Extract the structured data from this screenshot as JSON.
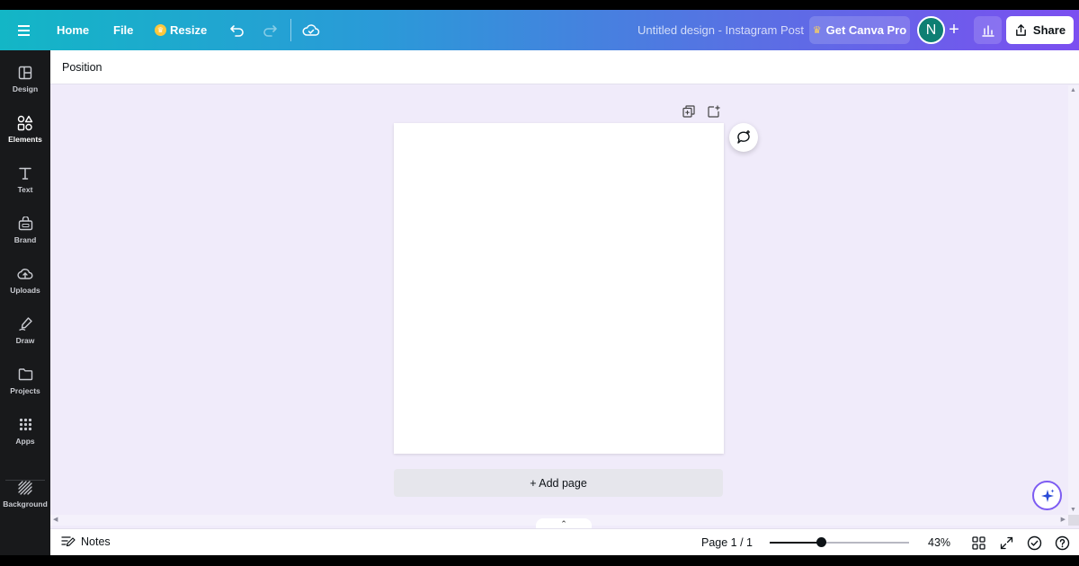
{
  "topbar": {
    "home_label": "Home",
    "file_label": "File",
    "resize_label": "Resize",
    "undo_icon": "undo-icon",
    "redo_icon": "redo-icon",
    "save_status_icon": "cloud-check-icon",
    "document_title": "Untitled design - Instagram Post",
    "get_pro_label": "Get Canva Pro",
    "avatar_initial": "N",
    "add_collaborator_icon": "plus-icon",
    "insights_icon": "bar-chart-icon",
    "share_label": "Share",
    "colors": {
      "gradient_start": "#13b6c6",
      "gradient_end": "#7b4ff0",
      "avatar": "#0e7f73",
      "crown": "#ffd35a"
    }
  },
  "sidebar": {
    "items": [
      {
        "label": "Design",
        "icon": "layout-icon"
      },
      {
        "label": "Elements",
        "icon": "shapes-icon"
      },
      {
        "label": "Text",
        "icon": "text-icon"
      },
      {
        "label": "Brand",
        "icon": "brand-icon"
      },
      {
        "label": "Uploads",
        "icon": "upload-cloud-icon"
      },
      {
        "label": "Draw",
        "icon": "pen-icon"
      },
      {
        "label": "Projects",
        "icon": "folder-icon"
      },
      {
        "label": "Apps",
        "icon": "apps-grid-icon"
      },
      {
        "label": "Background",
        "icon": "hatch-icon"
      }
    ],
    "active": "Elements"
  },
  "context_bar": {
    "position_label": "Position"
  },
  "canvas": {
    "duplicate_page_icon": "duplicate-icon",
    "add_page_icon": "add-page-icon",
    "comment_icon": "add-comment-icon",
    "add_page_label": "+ Add page",
    "magic_icon": "sparkle-icon",
    "collapse_icon": "chevron-up-icon"
  },
  "bottombar": {
    "notes_label": "Notes",
    "page_indicator": "Page 1 / 1",
    "zoom_fraction": 0.37,
    "zoom_value": "43%",
    "grid_view_icon": "grid-view-icon",
    "fullscreen_icon": "expand-icon",
    "check_icon": "check-circle-icon",
    "help_icon": "help-circle-icon"
  }
}
